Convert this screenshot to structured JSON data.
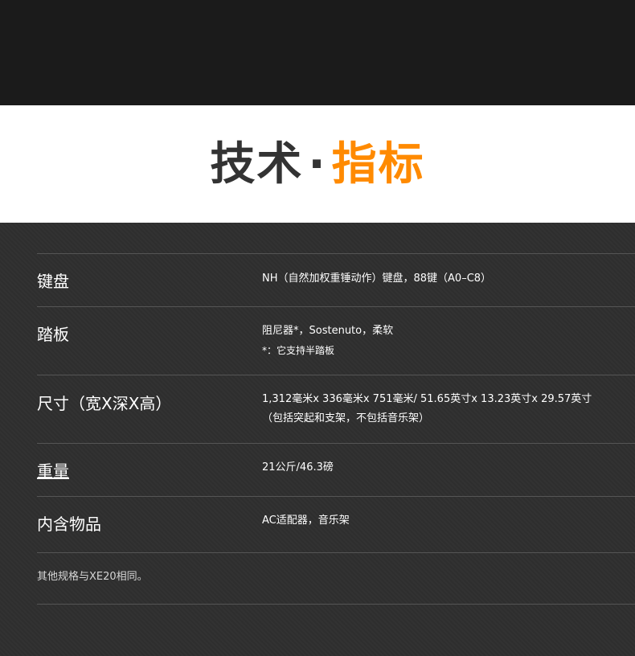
{
  "header": {
    "title_part1": "技术",
    "title_dot": "·",
    "title_part2": "指标",
    "accent_color": "#ff8a00"
  },
  "specs": [
    {
      "label": "键盘",
      "value_lines": [
        "NH（自然加权重锤动作）键盘，88键（A0–C8）"
      ]
    },
    {
      "label": "踏板",
      "value_lines": [
        "阻尼器*，Sostenuto，柔软",
        "*：它支持半踏板"
      ]
    },
    {
      "label": "尺寸（宽X深X高）",
      "value_lines": [
        "1,312毫米x 336毫米x 751毫米/ 51.65英寸x 13.23英寸x 29.57英寸",
        "（包括突起和支架，不包括音乐架）"
      ]
    },
    {
      "label": "重量",
      "value_lines": [
        "21公斤/46.3磅"
      ]
    },
    {
      "label": "内含物品",
      "value_lines": [
        "AC适配器，音乐架"
      ]
    }
  ],
  "note": "其他规格与XE20相同。"
}
